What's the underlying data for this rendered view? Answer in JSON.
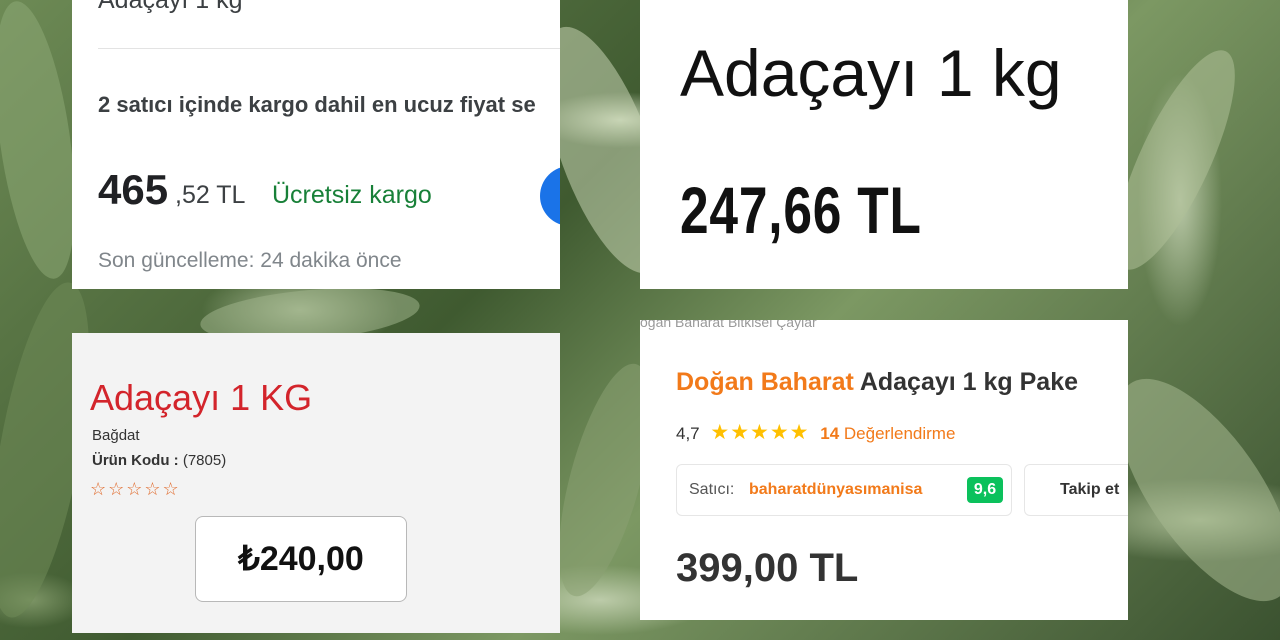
{
  "panel1": {
    "title": "Adaçayı 1 kg",
    "compare_text": "2 satıcı içinde kargo dahil en ucuz fiyat se",
    "price_int": "465",
    "price_dec": ",52 TL",
    "shipping": "Ücretsiz kargo",
    "updated": "Son güncelleme: 24 dakika önce"
  },
  "panel2": {
    "title": "Adaçayı 1 kg",
    "price": "247,66 TL"
  },
  "panel3": {
    "title": "Adaçayı 1 KG",
    "brand": "Bağdat",
    "code_label": "Ürün Kodu :",
    "code_value": "(7805)",
    "stars": "☆☆☆☆☆",
    "price": "₺240,00"
  },
  "panel4": {
    "breadcrumb": "oğan Baharat Bitkisel Çaylar",
    "brand": "Doğan Baharat",
    "title": " Adaçayı 1 kg Pake",
    "rating": "4,7",
    "rating_stars": "★★★★★",
    "review_count": "14",
    "review_label": "Değerlendirme",
    "seller_label": "Satıcı:",
    "seller_name": "baharatdünyasımanisa",
    "seller_score": "9,6",
    "follow_label": "Takip et",
    "price": "399,00 TL"
  },
  "colors": {
    "shipping_green": "#188038",
    "title_red": "#d3242b",
    "brand_orange": "#f27a1a",
    "seller_score_green": "#0bc15c",
    "star_yellow": "#ffc000"
  }
}
